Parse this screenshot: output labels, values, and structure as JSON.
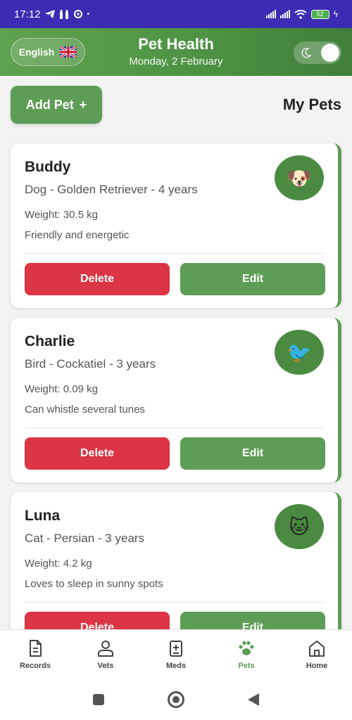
{
  "status_bar": {
    "time": "17:12",
    "battery": "52",
    "icons": [
      "telegram-icon",
      "notification-icon",
      "settings-icon",
      "signal-icon",
      "wifi-icon",
      "battery-icon",
      "charging-icon"
    ]
  },
  "header": {
    "language": "English",
    "title": "Pet Health",
    "date": "Monday, 2 February",
    "theme_toggle": "off"
  },
  "toolbar": {
    "add_pet_label": "Add Pet",
    "add_icon": "+",
    "section_title": "My Pets"
  },
  "pets": [
    {
      "name": "Buddy",
      "breed_line": "Dog - Golden Retriever - 4 years",
      "weight": "Weight: 30.5 kg",
      "notes": "Friendly and energetic",
      "emoji": "🐶",
      "delete_label": "Delete",
      "edit_label": "Edit"
    },
    {
      "name": "Charlie",
      "breed_line": "Bird - Cockatiel - 3 years",
      "weight": "Weight: 0.09 kg",
      "notes": "Can whistle several tunes",
      "emoji": "🐦",
      "delete_label": "Delete",
      "edit_label": "Edit"
    },
    {
      "name": "Luna",
      "breed_line": "Cat - Persian - 3 years",
      "weight": "Weight: 4.2 kg",
      "notes": "Loves to sleep in sunny spots",
      "emoji": "🐱",
      "delete_label": "Delete",
      "edit_label": "Edit"
    }
  ],
  "bottom_nav": [
    {
      "label": "Records",
      "icon": "document-icon"
    },
    {
      "label": "Vets",
      "icon": "person-icon"
    },
    {
      "label": "Meds",
      "icon": "medicine-icon"
    },
    {
      "label": "Pets",
      "icon": "paw-icon",
      "active": true
    },
    {
      "label": "Home",
      "icon": "home-icon"
    }
  ],
  "colors": {
    "status_bar": "#3d2bb3",
    "primary": "#5d9d55",
    "danger": "#dc3545",
    "background": "#f3f3f3"
  }
}
